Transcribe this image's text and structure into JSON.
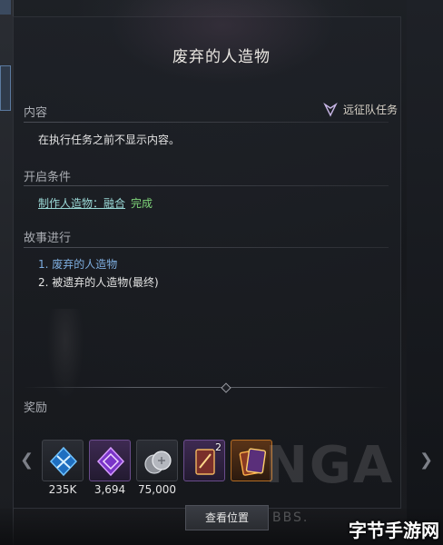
{
  "dialog": {
    "title": "废弃的人造物",
    "mission_tag": "远征队任务"
  },
  "content": {
    "label": "内容",
    "text": "在执行任务之前不显示内容。"
  },
  "conditions": {
    "label": "开启条件",
    "item_name": "制作人造物：融合",
    "item_status": "完成"
  },
  "story": {
    "label": "故事进行",
    "steps": [
      "1. 废弃的人造物",
      "2. 被遗弃的人造物(最终)"
    ]
  },
  "rewards": {
    "label": "奖励",
    "items": [
      {
        "icon": "blue-crystal-icon",
        "count": "235K"
      },
      {
        "icon": "purple-crystal-icon",
        "count": "3,694"
      },
      {
        "icon": "silver-coins-icon",
        "count": "75,000"
      },
      {
        "icon": "card-icon",
        "badge": "2"
      },
      {
        "icon": "card-icon"
      }
    ]
  },
  "buttons": {
    "view_location": "查看位置"
  },
  "watermarks": {
    "logo": "NGA",
    "site": "BBS.",
    "corner": "字节手游网"
  }
}
